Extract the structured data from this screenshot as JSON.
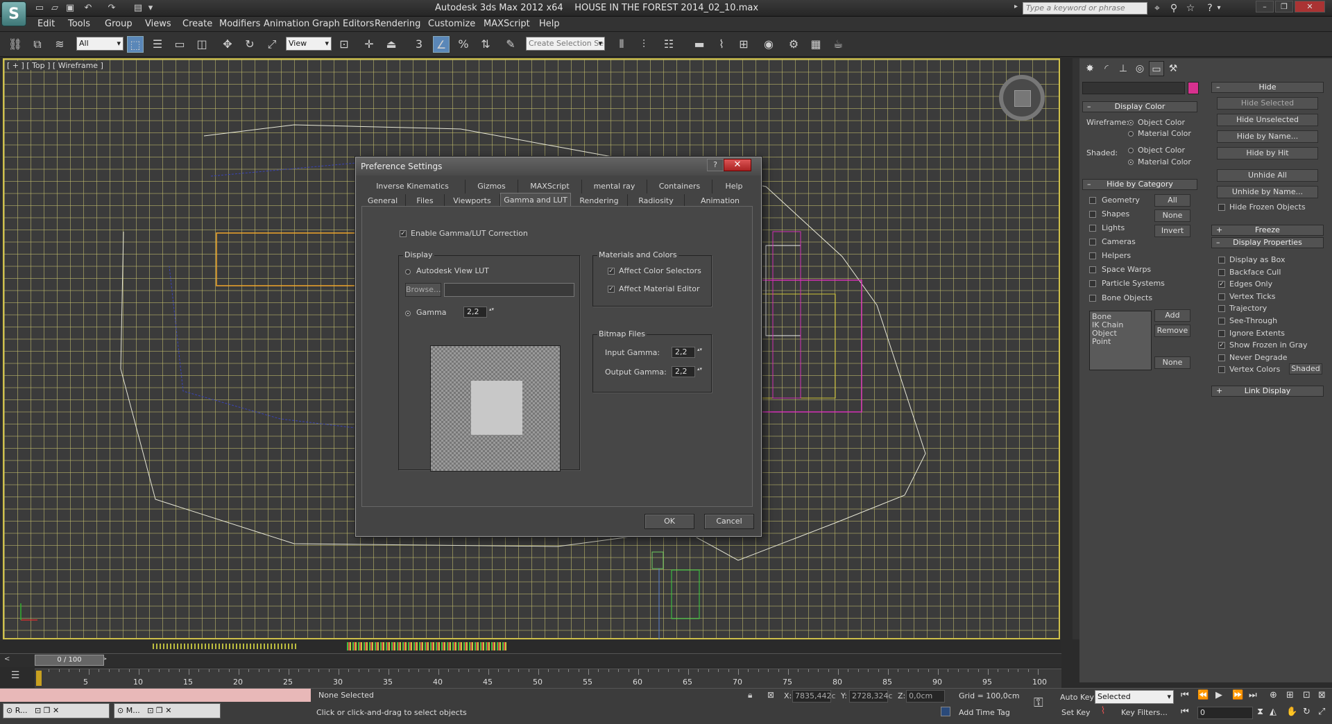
{
  "titlebar": {
    "app": "Autodesk 3ds Max  2012 x64",
    "file": "HOUSE IN THE FOREST 2014_02_10.max",
    "search_placeholder": "Type a keyword or phrase",
    "logo": "S"
  },
  "menu": [
    "Edit",
    "Tools",
    "Group",
    "Views",
    "Create",
    "Modifiers",
    "Animation",
    "Graph Editors",
    "Rendering",
    "Customize",
    "MAXScript",
    "Help"
  ],
  "toolbar": {
    "filter_select": "All",
    "coord_select": "View",
    "snap_label": "3",
    "named_selection": "Create Selection Se"
  },
  "viewport": {
    "label": "[ + ] [ Top ] [ Wireframe ]"
  },
  "command_panel": {
    "display_color": {
      "title": "Display Color",
      "wireframe_label": "Wireframe:",
      "shaded_label": "Shaded:",
      "object_color": "Object Color",
      "material_color": "Material Color"
    },
    "hide_by_category": {
      "title": "Hide by Category",
      "items": [
        "Geometry",
        "Shapes",
        "Lights",
        "Cameras",
        "Helpers",
        "Space Warps",
        "Particle Systems",
        "Bone Objects"
      ],
      "buttons": [
        "All",
        "None",
        "Invert"
      ],
      "list": [
        "Bone",
        "IK Chain Object",
        "Point"
      ],
      "add": "Add",
      "remove": "Remove",
      "none": "None"
    },
    "hide": {
      "title": "Hide",
      "buttons": [
        "Hide Selected",
        "Hide Unselected",
        "Hide by Name...",
        "Hide by Hit",
        "Unhide All",
        "Unhide by Name..."
      ],
      "hide_frozen": "Hide Frozen Objects"
    },
    "freeze": {
      "title": "Freeze"
    },
    "display_properties": {
      "title": "Display Properties",
      "items": [
        "Display as Box",
        "Backface Cull",
        "Edges Only",
        "Vertex Ticks",
        "Trajectory",
        "See-Through",
        "Ignore Extents",
        "Show Frozen in Gray",
        "Never Degrade",
        "Vertex Colors"
      ],
      "checked": [
        false,
        false,
        true,
        false,
        false,
        false,
        false,
        true,
        false,
        false
      ],
      "shaded_btn": "Shaded"
    },
    "link_display": {
      "title": "Link Display"
    }
  },
  "dialog": {
    "title": "Preference Settings",
    "help": "?",
    "close": "✕",
    "tabs_row1": [
      "Inverse Kinematics",
      "Gizmos",
      "MAXScript",
      "mental ray",
      "Containers",
      "Help"
    ],
    "tabs_row2": [
      "General",
      "Files",
      "Viewports",
      "Gamma and LUT",
      "Rendering",
      "Radiosity",
      "Animation"
    ],
    "active_tab": "Gamma and LUT",
    "enable_gamma": "Enable Gamma/LUT Correction",
    "display_group": "Display",
    "autodesk_lut": "Autodesk View LUT",
    "browse": "Browse...",
    "gamma_label": "Gamma",
    "gamma_value": "2,2",
    "materials_group": "Materials and Colors",
    "affect_color_selectors": "Affect Color Selectors",
    "affect_material_editor": "Affect Material Editor",
    "bitmap_group": "Bitmap Files",
    "input_gamma_label": "Input Gamma:",
    "input_gamma": "2,2",
    "output_gamma_label": "Output Gamma:",
    "output_gamma": "2,2",
    "ok": "OK",
    "cancel": "Cancel"
  },
  "timeline": {
    "slider": "0 / 100",
    "ticks": [
      "5",
      "10",
      "15",
      "20",
      "25",
      "30",
      "35",
      "40",
      "45",
      "50",
      "55",
      "60",
      "65",
      "70",
      "75",
      "80",
      "85",
      "90",
      "95",
      "100"
    ],
    "position": 0
  },
  "status": {
    "selection": "None Selected",
    "prompt": "Click or click-and-drag to select objects",
    "x_label": "X:",
    "x": "7835,442c",
    "y_label": "Y:",
    "y": "2728,324c",
    "z_label": "Z:",
    "z": "0,0cm",
    "grid": "Grid = 100,0cm",
    "add_time_tag": "Add Time Tag",
    "auto_key": "Auto Key",
    "set_key": "Set Key",
    "key_mode": "Selected",
    "key_filters": "Key Filters...",
    "frame": "0"
  },
  "taskbar": [
    "R...",
    "M..."
  ]
}
